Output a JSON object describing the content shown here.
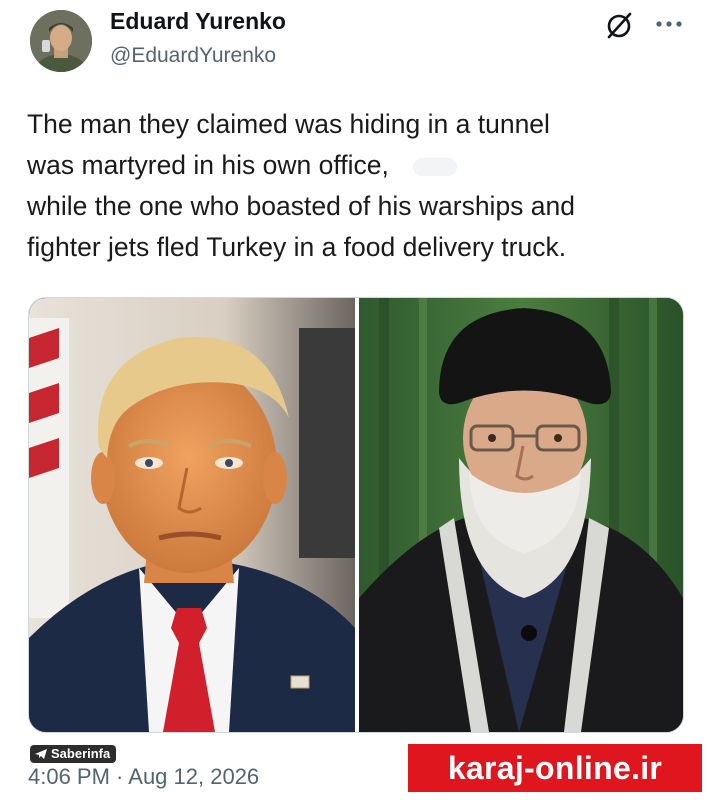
{
  "author": {
    "display_name": "Eduard Yurenko",
    "handle": "@EduardYurenko",
    "avatar_icon": "profile-photo-avatar"
  },
  "header_icons": {
    "brand_icon": "xai-slashed-circle-icon",
    "more_icon": "more-options-dots-icon"
  },
  "tweet": {
    "lines": [
      "The man they claimed was hiding in a tunnel",
      "was martyred in his own office,",
      "while the one who boasted of his warships and",
      "fighter jets fled Turkey in a food delivery truck."
    ]
  },
  "media": {
    "left_photo": "portrait-man-red-tie",
    "right_photo": "portrait-cleric-black-turban"
  },
  "footer": {
    "watermark": "Saberinfa",
    "timestamp": "4:06 PM · Aug 12, 2026",
    "site_banner": "karaj-online.ir"
  },
  "colors": {
    "text_primary": "#0f1419",
    "text_secondary": "#536471",
    "banner_red": "#e0161e",
    "border": "#cfd9de"
  }
}
